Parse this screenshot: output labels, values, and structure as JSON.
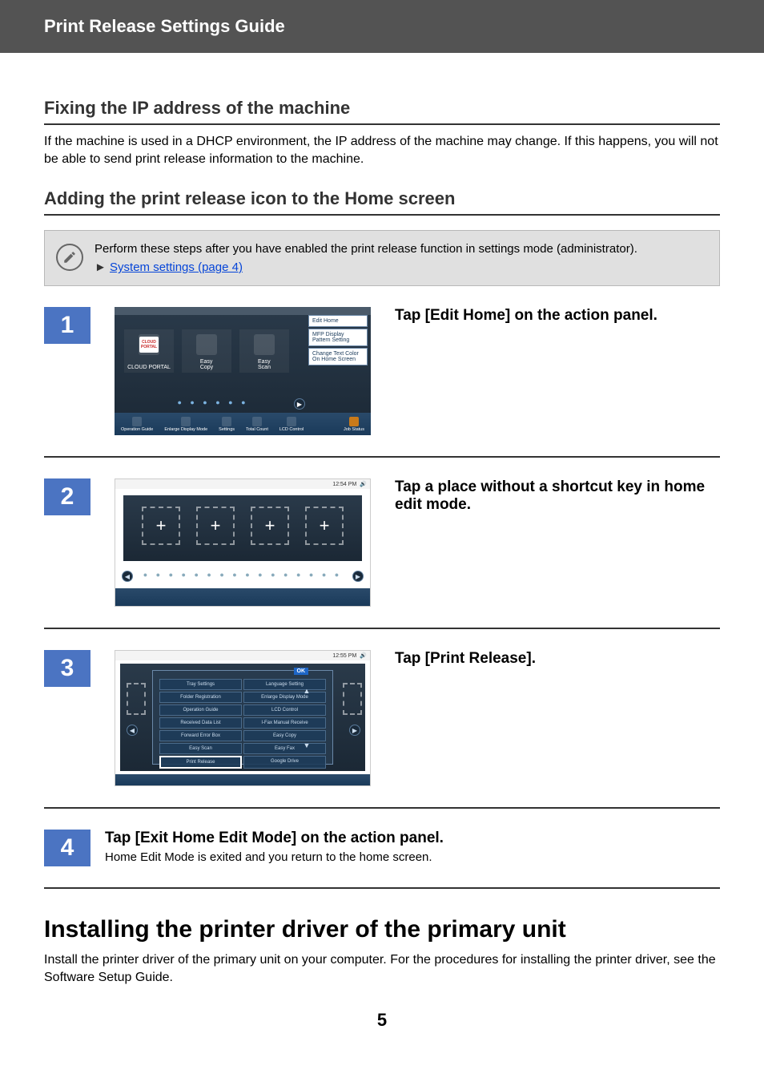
{
  "header": {
    "title": "Print Release Settings Guide"
  },
  "section1": {
    "heading": "Fixing the IP address of the machine",
    "para": "If the machine is used in a DHCP environment, the IP address of the machine may change. If this happens, you will not be able to send print release information to the machine."
  },
  "section2": {
    "heading": "Adding the print release icon to the Home screen"
  },
  "note": {
    "line1": "Perform these steps after you have enabled the print release function in settings mode (administrator).",
    "link_arrow": "►",
    "link_text": "System settings (page 4)"
  },
  "steps": [
    {
      "num": "1",
      "title": "Tap [Edit Home] on the action panel.",
      "panel": {
        "action_items": [
          "Edit Home",
          "MFP Display Pattern Setting",
          "Change Text Color On Home Screen"
        ],
        "tiles": [
          {
            "label": "CLOUD PORTAL",
            "icon": "cloud"
          },
          {
            "label": "Easy\nCopy",
            "icon": "copy"
          },
          {
            "label": "Easy\nScan",
            "icon": "scan"
          }
        ],
        "bottom": [
          "Operation Guide",
          "Enlarge Display Mode",
          "Settings",
          "Total Count",
          "LCD Control",
          "Job Status"
        ]
      }
    },
    {
      "num": "2",
      "title": "Tap a place without a shortcut key in home edit mode.",
      "panel": {
        "clock": "12:54 PM"
      }
    },
    {
      "num": "3",
      "title": "Tap [Print Release].",
      "panel": {
        "clock": "12:55 PM",
        "ok": "OK",
        "items_left": [
          "Tray Settings",
          "Folder Registration",
          "Operation Guide",
          "Received Data List",
          "Forward Error Box",
          "Easy Scan",
          "Print Release"
        ],
        "items_right": [
          "Language Setting",
          "Enlarge Display Mode",
          "LCD Control",
          "I-Fax Manual Receive",
          "Easy Copy",
          "Easy Fax",
          "Google Drive"
        ]
      }
    },
    {
      "num": "4",
      "title": "Tap [Exit Home Edit Mode] on the action panel.",
      "sub": "Home Edit Mode is exited and you return to the home screen."
    }
  ],
  "section3": {
    "heading": "Installing the printer driver of the primary unit",
    "para": "Install the printer driver of the primary unit on your computer. For the procedures for installing the printer driver, see the Software Setup Guide."
  },
  "page_number": "5"
}
